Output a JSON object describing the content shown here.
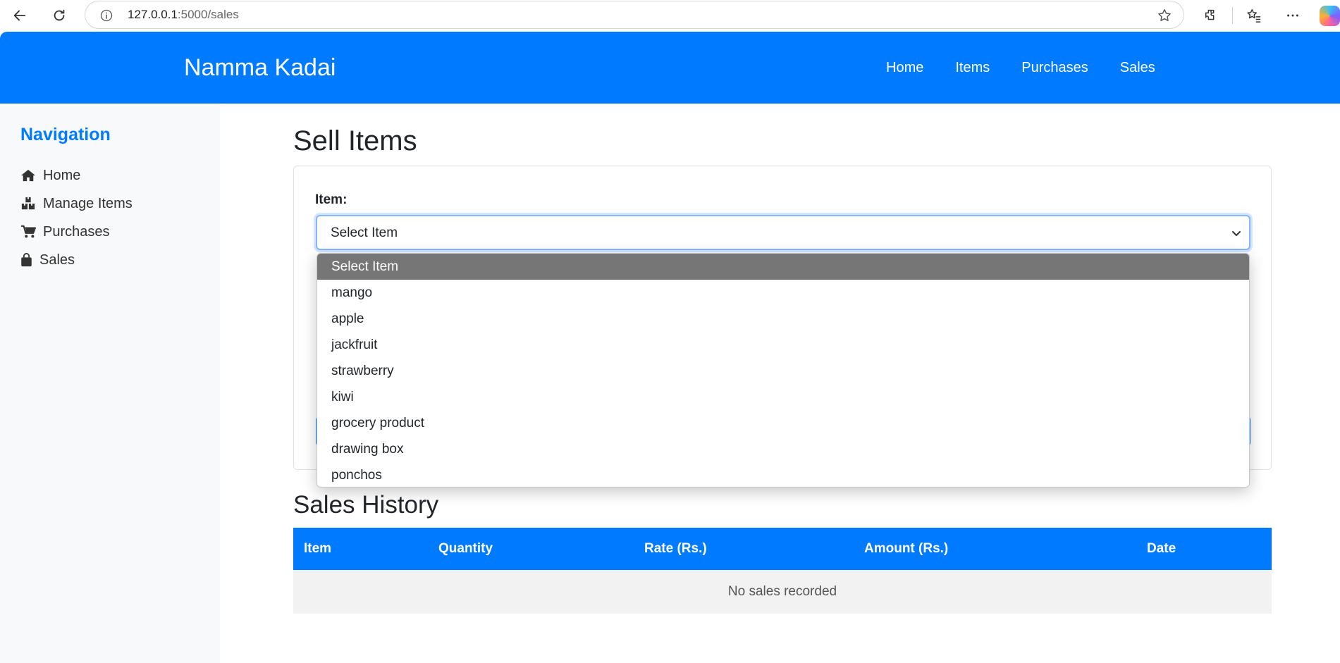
{
  "browser": {
    "url_host": "127.0.0.1",
    "url_path": ":5000/sales"
  },
  "navbar": {
    "brand": "Namma Kadai",
    "links": [
      "Home",
      "Items",
      "Purchases",
      "Sales"
    ]
  },
  "sidebar": {
    "title": "Navigation",
    "items": [
      {
        "label": "Home",
        "icon": "home-icon"
      },
      {
        "label": "Manage Items",
        "icon": "boxes-icon"
      },
      {
        "label": "Purchases",
        "icon": "cart-icon"
      },
      {
        "label": "Sales",
        "icon": "shopping-bag-icon"
      }
    ]
  },
  "sell_form": {
    "title": "Sell Items",
    "item_label": "Item:",
    "selected_value": "Select Item",
    "options": [
      "Select Item",
      "mango",
      "apple",
      "jackfruit",
      "strawberry",
      "kiwi",
      "grocery product",
      "drawing box",
      "ponchos"
    ]
  },
  "history": {
    "title": "Sales History",
    "columns": [
      "Item",
      "Quantity",
      "Rate (Rs.)",
      "Amount (Rs.)",
      "Date"
    ],
    "empty_message": "No sales recorded"
  },
  "colors": {
    "primary": "#007bff",
    "sidebar_bg": "#f8f9fa",
    "selected_option_bg": "#767676"
  }
}
